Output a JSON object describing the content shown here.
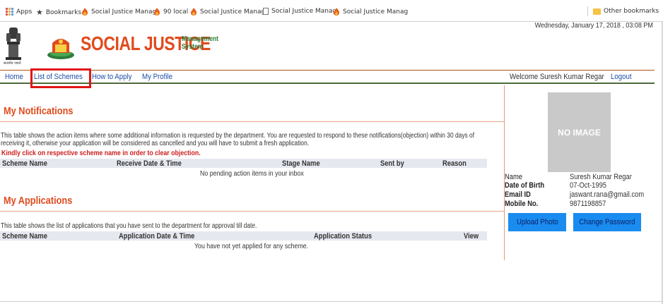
{
  "bookmarks": {
    "apps": "Apps",
    "bookmarks": "Bookmarks",
    "items": [
      "Social Justice Manag",
      "90 local",
      "Social Justice Manag",
      "Social Justice Manag",
      "Social Justice Manag"
    ],
    "other": "Other bookmarks"
  },
  "header": {
    "emblem_caption": "सत्यमेव जयते",
    "logo_title": "SOCIAL JUSTICE",
    "logo_sub_1": "Management",
    "logo_sub_2": "System",
    "date": "Wednesday, January 17, 2018 , 03:08 PM"
  },
  "nav": {
    "home": "Home",
    "list_of_schemes": "List of Schemes",
    "how_to_apply": "How to Apply",
    "my_profile": "My Profile",
    "welcome": "Welcome Suresh Kumar Regar",
    "logout": "Logout"
  },
  "notifications": {
    "title": "My Notifications",
    "description": "This table shows the action items where some additional information is requested by the department. You are requested to respond to these notifications(objection) within 30 days of receiving it, otherwise your application will be considered as cancelled and you will have to submit a fresh application.",
    "note": "Kindly click on respective scheme name in order to clear objection.",
    "columns": [
      "Scheme Name",
      "Receive Date & Time",
      "Stage Name",
      "Sent by",
      "Reason"
    ],
    "empty": "No pending action items in your inbox"
  },
  "applications": {
    "title": "My Applications",
    "description": "This table shows the list of applications that you have sent to the department for approval till date.",
    "columns": [
      "Scheme Name",
      "Application Date & Time",
      "Application Status",
      "View"
    ],
    "empty": "You have not yet applied for any scheme."
  },
  "profile": {
    "photo_placeholder": "NO IMAGE",
    "name_label": "Name",
    "name": "Suresh Kumar Regar",
    "dob_label": "Date of Birth",
    "dob": "07-Oct-1995",
    "email_label": "Email ID",
    "email": "jaswant.rana@gmail.com",
    "mobile_label": "Mobile No.",
    "mobile": "9871198857",
    "upload_photo": "Upload Photo",
    "change_password": "Change Password"
  },
  "colors": {
    "accent_orange": "#e04b1d",
    "link_blue": "#1f4fa8",
    "button_blue": "#1a8cf0",
    "highlight_red": "#e01616"
  }
}
